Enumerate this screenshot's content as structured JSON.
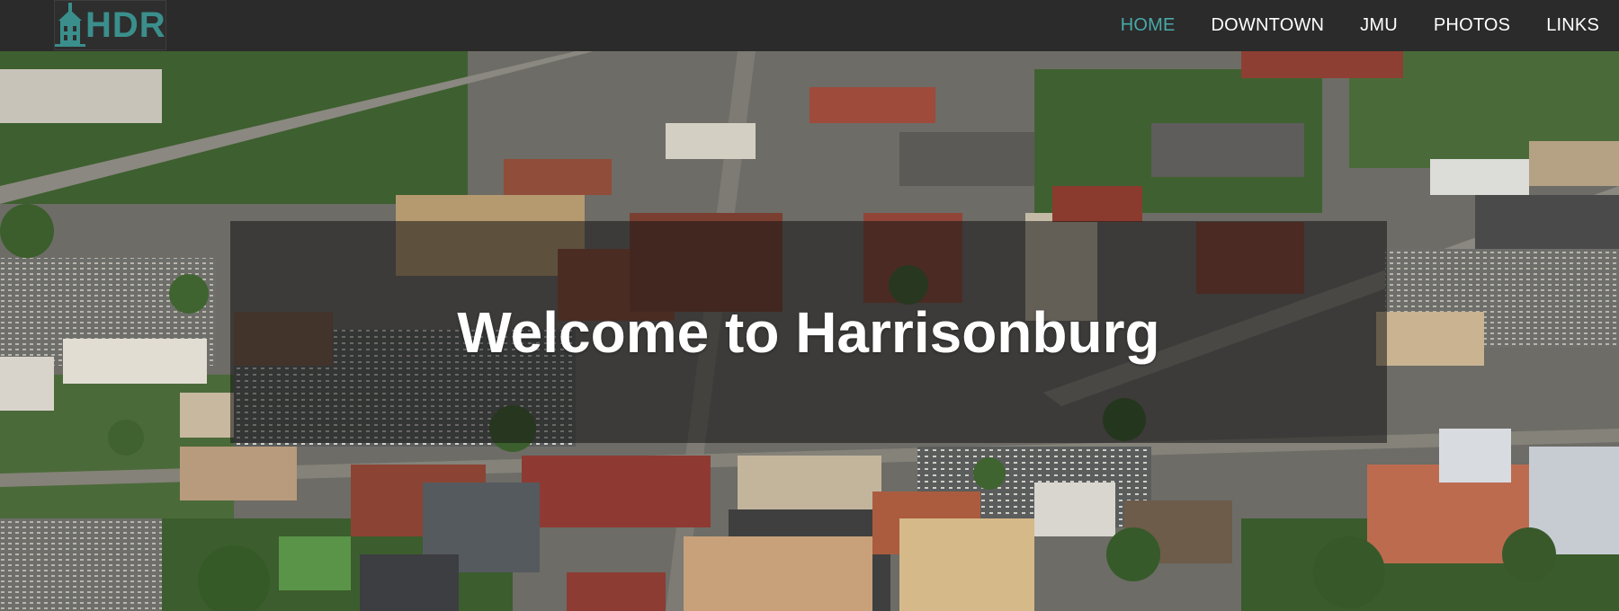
{
  "brand": {
    "logo_text": "HDR",
    "logo_icon": "building-icon",
    "accent_color": "#3a8f8c"
  },
  "nav": {
    "items": [
      {
        "label": "HOME",
        "active": true
      },
      {
        "label": "DOWNTOWN",
        "active": false
      },
      {
        "label": "JMU",
        "active": false
      },
      {
        "label": "PHOTOS",
        "active": false
      },
      {
        "label": "LINKS",
        "active": false
      }
    ],
    "active_color": "#4aa9a8"
  },
  "hero": {
    "title": "Welcome to Harrisonburg",
    "background": "aerial photo of downtown"
  }
}
